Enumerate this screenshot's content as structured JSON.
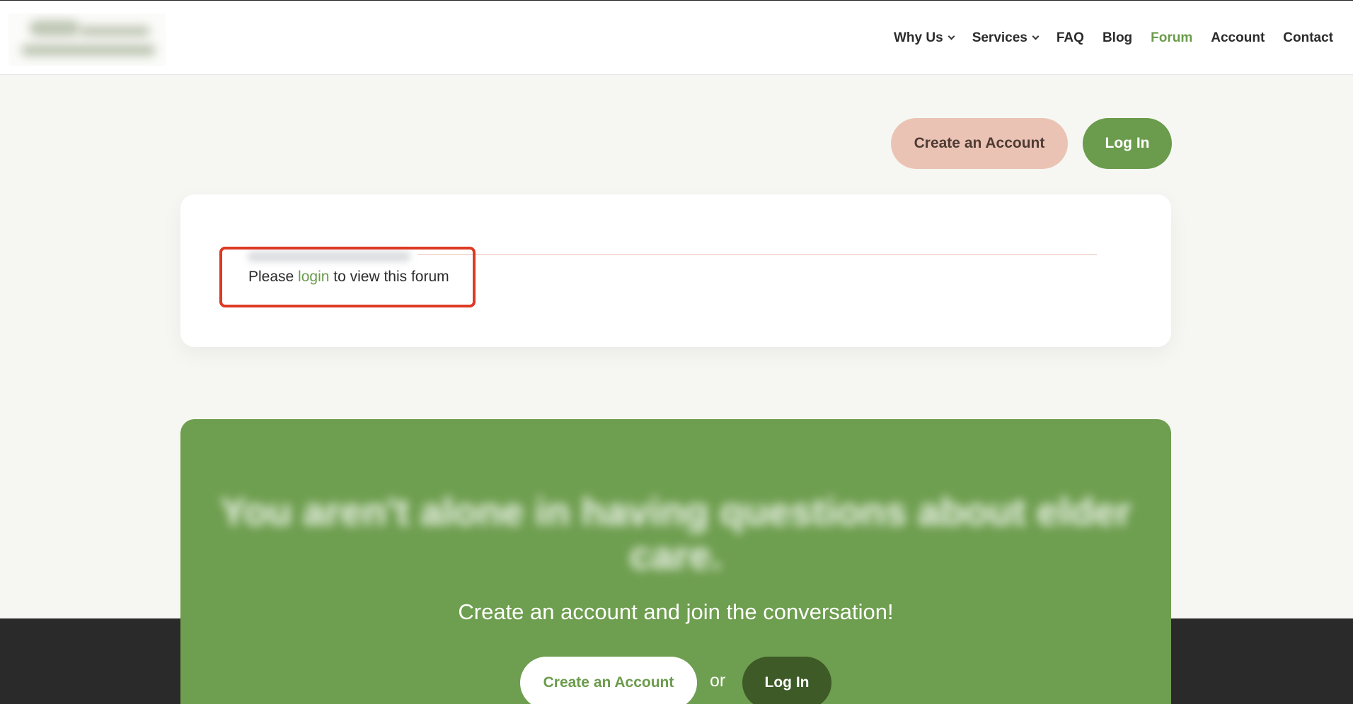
{
  "header": {
    "nav": [
      {
        "label": "Why Us",
        "has_dropdown": true,
        "active": false
      },
      {
        "label": "Services",
        "has_dropdown": true,
        "active": false
      },
      {
        "label": "FAQ",
        "has_dropdown": false,
        "active": false
      },
      {
        "label": "Blog",
        "has_dropdown": false,
        "active": false
      },
      {
        "label": "Forum",
        "has_dropdown": false,
        "active": true
      },
      {
        "label": "Account",
        "has_dropdown": false,
        "active": false
      },
      {
        "label": "Contact",
        "has_dropdown": false,
        "active": false
      }
    ]
  },
  "top_actions": {
    "create_label": "Create an Account",
    "login_label": "Log In"
  },
  "forum_card": {
    "notice_prefix": "Please ",
    "notice_link": "login",
    "notice_suffix": " to view this forum"
  },
  "cta": {
    "headline": "You aren't alone in having questions about elder care.",
    "subtitle": "Create an account and join the conversation!",
    "create_label": "Create an Account",
    "or_label": "or",
    "login_label": "Log In"
  },
  "colors": {
    "accent_green": "#6b9b4c",
    "dark_green": "#3d5a27",
    "peach": "#eac3b4",
    "highlight_red": "#dd3a24",
    "page_bg": "#f6f7f2",
    "footer_dark": "#2a2a2a"
  }
}
